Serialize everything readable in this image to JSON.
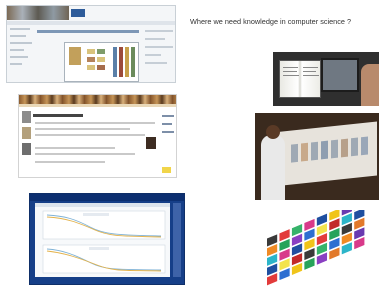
{
  "slide": {
    "title": "Where we need knowledge in computer science ?"
  },
  "screenshots": [
    {
      "id": "library-catalogue-ui",
      "description_icon": "web-page-icon"
    },
    {
      "id": "cultural-portal-ui",
      "description_icon": "web-page-icon"
    },
    {
      "id": "data-chart-ui",
      "description_icon": "chart-icon"
    }
  ],
  "photos": [
    {
      "id": "reader-with-book-and-monitor",
      "icon": "photo-icon"
    },
    {
      "id": "man-at-interactive-wall",
      "icon": "photo-icon"
    },
    {
      "id": "colour-mosaic-grid",
      "icon": "photo-icon"
    }
  ],
  "colors": {
    "chart_frame": "#163f88",
    "chart_line_1": "#7fb2d6",
    "chart_line_2": "#e3b24b",
    "portal_strip": "#8a5a2e"
  }
}
